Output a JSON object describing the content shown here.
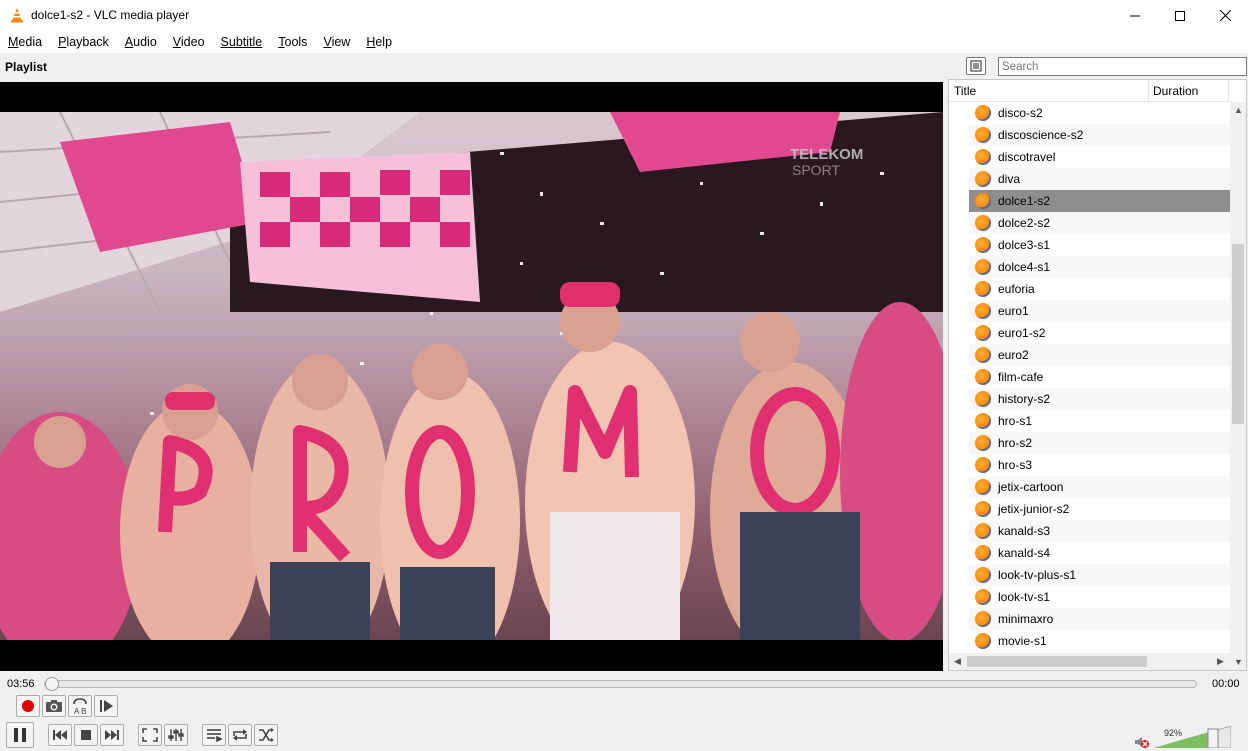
{
  "window": {
    "title": "dolce1-s2 - VLC media player"
  },
  "menu": [
    {
      "key": "M",
      "rest": "edia"
    },
    {
      "key": "P",
      "rest": "layback"
    },
    {
      "key": "A",
      "rest": "udio"
    },
    {
      "key": "V",
      "rest": "ideo"
    },
    {
      "key": "",
      "rest": "Subtitle",
      "u_index": 0
    },
    {
      "key": "T",
      "rest": "ools"
    },
    {
      "key": "V",
      "rest": "iew"
    },
    {
      "key": "H",
      "rest": "elp"
    }
  ],
  "playlist": {
    "label": "Playlist",
    "search_placeholder": "Search",
    "columns": {
      "title": "Title",
      "duration": "Duration"
    },
    "items": [
      "disco-s2",
      "discoscience-s2",
      "discotravel",
      "diva",
      "dolce1-s2",
      "dolce2-s2",
      "dolce3-s1",
      "dolce4-s1",
      "euforia",
      "euro1",
      "euro1-s2",
      "euro2",
      "film-cafe",
      "history-s2",
      "hro-s1",
      "hro-s2",
      "hro-s3",
      "jetix-cartoon",
      "jetix-junior-s2",
      "kanald-s3",
      "kanald-s4",
      "look-tv-plus-s1",
      "look-tv-s1",
      "minimaxro",
      "movie-s1"
    ],
    "selected_index": 4
  },
  "video": {
    "watermark_line1": "TELEKOM",
    "watermark_line2": "SPORT"
  },
  "player": {
    "elapsed": "03:56",
    "total": "00:00",
    "seek_fraction": 0.0,
    "volume_label": "92%",
    "volume_fraction": 0.92,
    "muted": true
  },
  "colors": {
    "record": "#e00000",
    "selected_row": "#8e8e8e",
    "volume_fill": "#7fbf5f"
  }
}
